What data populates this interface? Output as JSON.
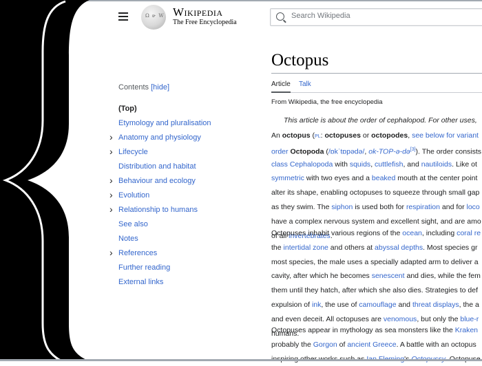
{
  "header": {
    "menu_icon": "hamburger-icon",
    "logo": {
      "wordmark": "Wikipedia",
      "tagline": "The Free Encyclopedia",
      "icon": "wikipedia-globe-icon"
    },
    "search": {
      "placeholder": "Search Wikipedia",
      "value": "",
      "icon": "search-icon"
    }
  },
  "toc": {
    "title": "Contents",
    "hide_label": "[hide]",
    "items": [
      {
        "label": "(Top)",
        "expandable": false
      },
      {
        "label": "Etymology and pluralisation",
        "expandable": false
      },
      {
        "label": "Anatomy and physiology",
        "expandable": true
      },
      {
        "label": "Lifecycle",
        "expandable": true
      },
      {
        "label": "Distribution and habitat",
        "expandable": false
      },
      {
        "label": "Behaviour and ecology",
        "expandable": true
      },
      {
        "label": "Evolution",
        "expandable": true
      },
      {
        "label": "Relationship to humans",
        "expandable": true
      },
      {
        "label": "See also",
        "expandable": false
      },
      {
        "label": "Notes",
        "expandable": false
      },
      {
        "label": "References",
        "expandable": true
      },
      {
        "label": "Further reading",
        "expandable": false
      },
      {
        "label": "External links",
        "expandable": false
      }
    ]
  },
  "article": {
    "title": "Octopus",
    "tabs": [
      {
        "label": "Article",
        "active": true
      },
      {
        "label": "Talk",
        "active": false
      }
    ],
    "from": "From Wikipedia, the free encyclopedia",
    "hatnote": "This article is about the order of cephalopod. For other uses,",
    "p1": [
      [
        {
          "t": "An "
        },
        {
          "t": "octopus",
          "b": true
        },
        {
          "t": " ("
        },
        {
          "t": "PL",
          "l": true
        },
        {
          "t": ": "
        },
        {
          "t": "octopuses",
          "b": true
        },
        {
          "t": " or "
        },
        {
          "t": "octopodes",
          "b": true
        },
        {
          "t": ", "
        },
        {
          "t": "see below for variant",
          "l": true
        }
      ],
      [
        {
          "t": "order",
          "l": true
        },
        {
          "t": " "
        },
        {
          "t": "Octopoda",
          "b": true
        },
        {
          "t": " ("
        },
        {
          "t": "/ɒkˈtɒpədə/",
          "l": true
        },
        {
          "t": ", "
        },
        {
          "t": "ok-TOP-ə-də",
          "l": true,
          "i": true
        },
        {
          "t": "[3]",
          "l": true
        },
        {
          "t": "). The order consists"
        }
      ],
      [
        {
          "t": "class Cephalopoda",
          "l": true
        },
        {
          "t": " with "
        },
        {
          "t": "squids",
          "l": true
        },
        {
          "t": ", "
        },
        {
          "t": "cuttlefish",
          "l": true
        },
        {
          "t": ", and "
        },
        {
          "t": "nautiloids",
          "l": true
        },
        {
          "t": ". Like ot"
        }
      ],
      [
        {
          "t": "symmetric",
          "l": true
        },
        {
          "t": " with two eyes and a "
        },
        {
          "t": "beaked",
          "l": true
        },
        {
          "t": " mouth at the center point"
        }
      ],
      [
        {
          "t": "alter its shape, enabling octopuses to squeeze through small gap"
        }
      ],
      [
        {
          "t": "as they swim. The "
        },
        {
          "t": "siphon",
          "l": true
        },
        {
          "t": " is used both for "
        },
        {
          "t": "respiration",
          "l": true
        },
        {
          "t": " and for "
        },
        {
          "t": "loco",
          "l": true
        }
      ],
      [
        {
          "t": "have a complex nervous system and excellent sight, and are amo"
        }
      ],
      [
        {
          "t": "of all "
        },
        {
          "t": "invertebrates",
          "l": true
        },
        {
          "t": "."
        }
      ]
    ],
    "p2": [
      [
        {
          "t": "Octopuses inhabit various regions of the "
        },
        {
          "t": "ocean",
          "l": true
        },
        {
          "t": ", including "
        },
        {
          "t": "coral re",
          "l": true
        }
      ],
      [
        {
          "t": "the "
        },
        {
          "t": "intertidal zone",
          "l": true
        },
        {
          "t": " and others at "
        },
        {
          "t": "abyssal depths",
          "l": true
        },
        {
          "t": ". Most species gr"
        }
      ],
      [
        {
          "t": "most species, the male uses a specially adapted arm to deliver a"
        }
      ],
      [
        {
          "t": "cavity, after which he becomes "
        },
        {
          "t": "senescent",
          "l": true
        },
        {
          "t": " and dies, while the fem"
        }
      ],
      [
        {
          "t": "them until they hatch, after which she also dies. Strategies to def"
        }
      ],
      [
        {
          "t": "expulsion of "
        },
        {
          "t": "ink",
          "l": true
        },
        {
          "t": ", the use of "
        },
        {
          "t": "camouflage",
          "l": true
        },
        {
          "t": " and "
        },
        {
          "t": "threat displays",
          "l": true
        },
        {
          "t": ", the a"
        }
      ],
      [
        {
          "t": "and even deceit. All octopuses are "
        },
        {
          "t": "venomous",
          "l": true
        },
        {
          "t": ", but only the "
        },
        {
          "t": "blue-r",
          "l": true
        }
      ],
      [
        {
          "t": "humans."
        }
      ]
    ],
    "p3": [
      [
        {
          "t": "Octopuses appear in mythology as sea monsters like the "
        },
        {
          "t": "Kraken",
          "l": true
        }
      ],
      [
        {
          "t": "probably the "
        },
        {
          "t": "Gorgon",
          "l": true
        },
        {
          "t": " of "
        },
        {
          "t": "ancient Greece",
          "l": true
        },
        {
          "t": ". A battle with an octopus"
        }
      ],
      [
        {
          "t": "inspiring other works such as "
        },
        {
          "t": "Ian Fleming",
          "l": true
        },
        {
          "t": "'s "
        },
        {
          "t": "Octopussy",
          "l": true,
          "i": true
        },
        {
          "t": ". Octopuse"
        }
      ]
    ]
  },
  "colors": {
    "link": "#3366cc",
    "text": "#202122",
    "decoration": "#000000"
  }
}
